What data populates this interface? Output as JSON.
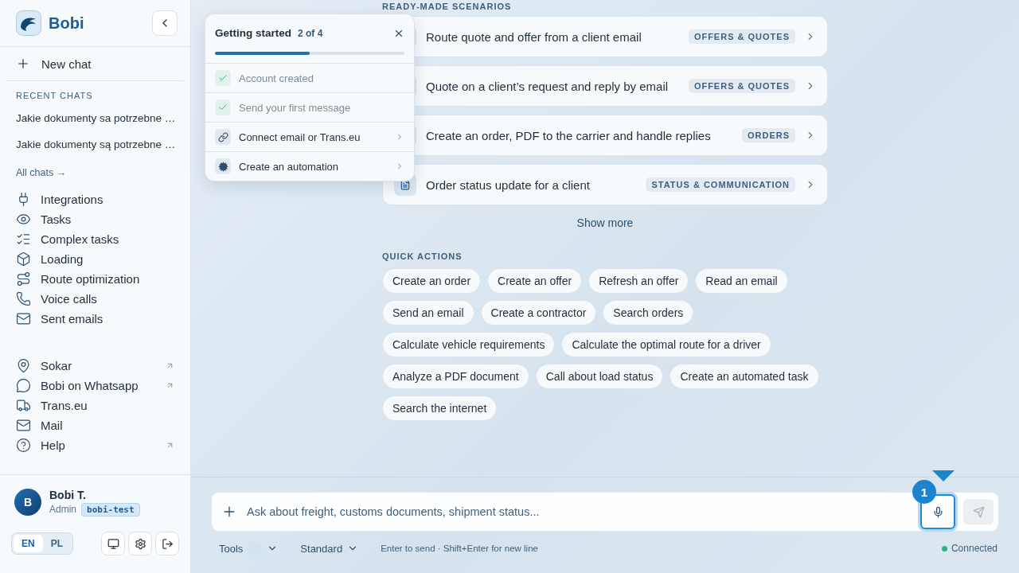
{
  "brand": {
    "name": "Bobi"
  },
  "sidebar": {
    "new_chat": "New chat",
    "recent_heading": "RECENT CHATS",
    "recent_chats": [
      "Jakie dokumenty sa potrzebne …",
      "Jakie dokumenty są potrzebne …"
    ],
    "all_chats": "All chats →",
    "nav_items": [
      {
        "label": "Integrations"
      },
      {
        "label": "Tasks"
      },
      {
        "label": "Complex tasks"
      },
      {
        "label": "Loading"
      },
      {
        "label": "Route optimization"
      },
      {
        "label": "Voice calls"
      },
      {
        "label": "Sent emails"
      }
    ],
    "external_items": [
      {
        "label": "Sokar",
        "external": true
      },
      {
        "label": "Bobi on Whatsapp",
        "external": true
      },
      {
        "label": "Trans.eu",
        "external": false
      },
      {
        "label": "Mail",
        "external": false
      },
      {
        "label": "Help",
        "external": true
      }
    ],
    "user": {
      "initial": "B",
      "name": "Bobi T.",
      "role": "Admin",
      "workspace": "bobi-test"
    },
    "languages": [
      {
        "label": "EN",
        "selected": true
      },
      {
        "label": "PL",
        "selected": false
      }
    ]
  },
  "getting_started": {
    "title": "Getting started",
    "progress_text": "2 of 4",
    "level": 0.5,
    "steps": [
      {
        "label": "Account created",
        "done": true
      },
      {
        "label": "Send your first message",
        "done": true
      },
      {
        "label": "Connect email or Trans.eu",
        "done": false
      },
      {
        "label": "Create an automation",
        "done": false
      }
    ]
  },
  "scenarios": {
    "heading": "READY-MADE SCENARIOS",
    "items": [
      {
        "title": "Route quote and offer from a client email",
        "tag": "OFFERS & QUOTES"
      },
      {
        "title": "Quote on a client’s request and reply by email",
        "tag": "OFFERS & QUOTES"
      },
      {
        "title": "Create an order, PDF to the carrier and handle replies",
        "tag": "ORDERS"
      },
      {
        "title": "Order status update for a client",
        "tag": "STATUS & COMMUNICATION"
      }
    ],
    "show_more": "Show more"
  },
  "quick_actions": {
    "heading": "QUICK ACTIONS",
    "items": [
      "Create an order",
      "Create an offer",
      "Refresh an offer",
      "Read an email",
      "Send an email",
      "Create a contractor",
      "Search orders",
      "Calculate vehicle requirements",
      "Calculate the optimal route for a driver",
      "Analyze a PDF document",
      "Call about load status",
      "Create an automated task",
      "Search the internet"
    ]
  },
  "composer": {
    "placeholder": "Ask about freight, customs documents, shipment status...",
    "tour_step": "1",
    "tools": "Tools",
    "mode": "Standard",
    "hint": "Enter to send · Shift+Enter for new line",
    "status": "Connected",
    "connected": true
  }
}
